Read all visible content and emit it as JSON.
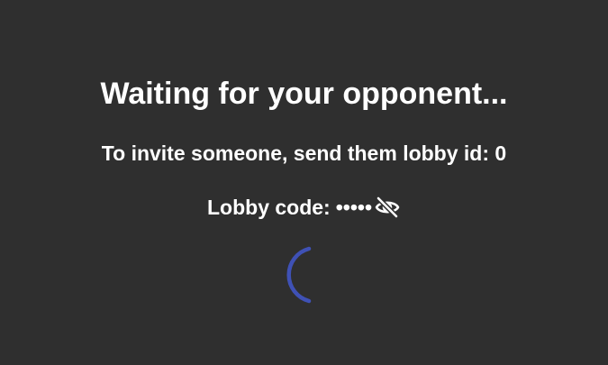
{
  "status": {
    "title": "Waiting for your opponent...",
    "invite_text": "To invite someone, send them lobby id: 0",
    "lobby_code_label": "Lobby code:",
    "lobby_code_value": "•••••"
  },
  "icons": {
    "visibility_toggle": "eye-slash-icon"
  },
  "spinner": {
    "color": "#3f51b5"
  }
}
